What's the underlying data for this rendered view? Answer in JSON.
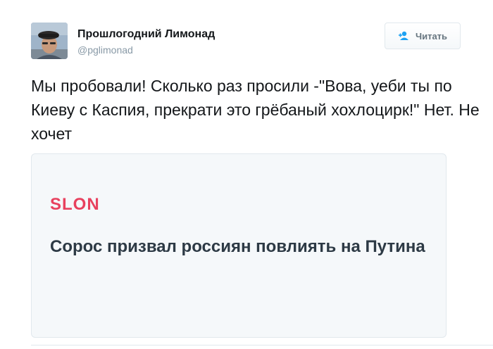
{
  "user": {
    "display_name": "Прошлогодний Лимонад",
    "handle": "@pglimonad"
  },
  "follow_button": {
    "label": "Читать",
    "icon": "person-plus-icon"
  },
  "tweet": {
    "text": "Мы пробовали! Сколько раз просили -\"Вова, уеби ты по Киеву с Каспия, прекрати это грёбаный хохлоцирк!\" Нет. Не хочет"
  },
  "card": {
    "source": "SLON",
    "headline": "Сорос призвал россиян повлиять на Путина"
  },
  "colors": {
    "source_brand": "#e8415e",
    "follow_icon": "#1da1f2"
  }
}
